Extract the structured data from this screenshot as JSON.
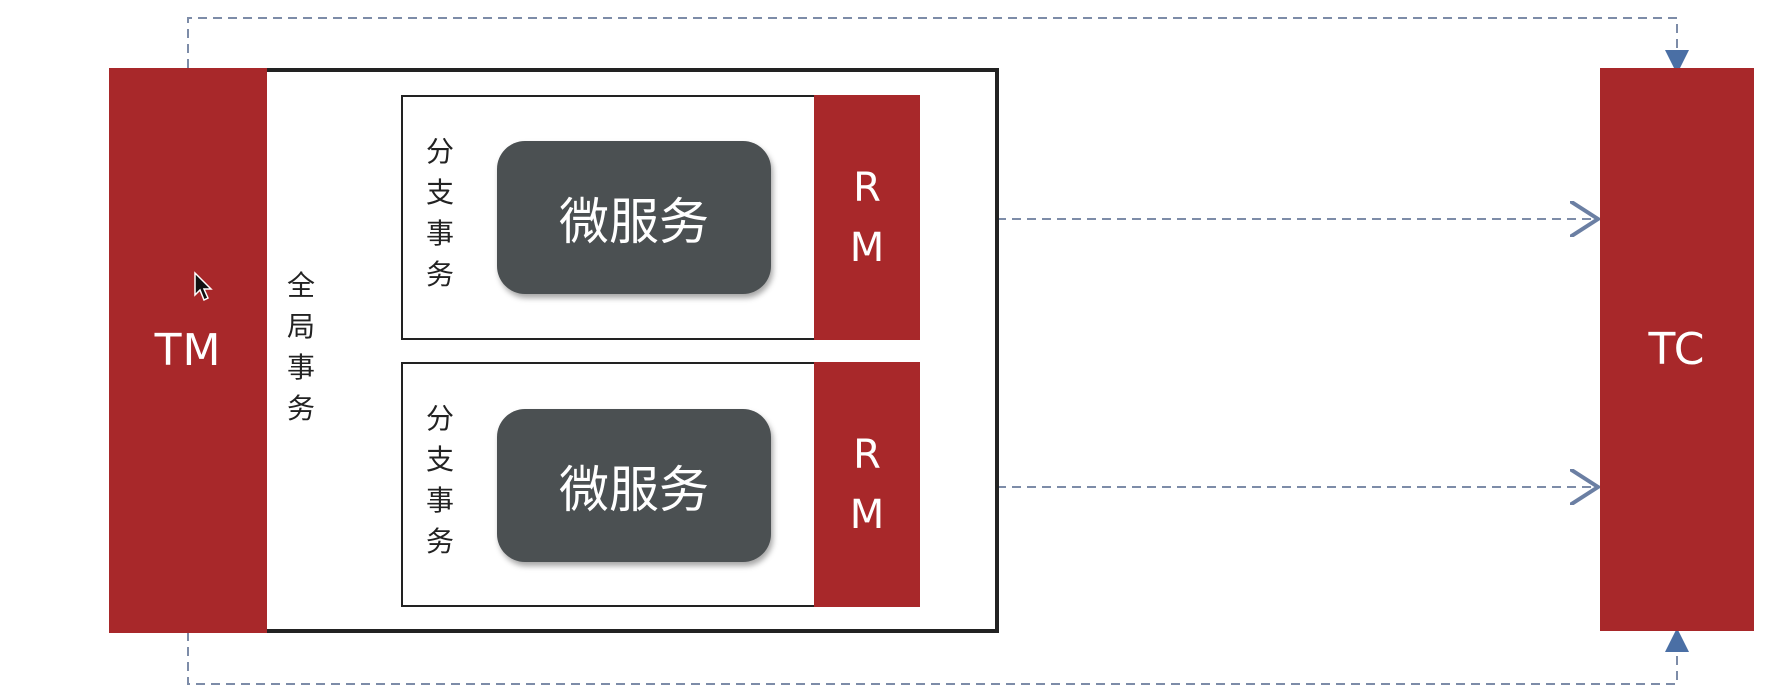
{
  "tm": {
    "label": "TM"
  },
  "tc": {
    "label": "TC"
  },
  "global_transaction": {
    "label": "全局事务"
  },
  "branches": [
    {
      "label": "分支事务",
      "service": "微服务",
      "rm": "R\nM"
    },
    {
      "label": "分支事务",
      "service": "微服务",
      "rm": "R\nM"
    }
  ],
  "colors": {
    "block": "#a8282a",
    "service": "#4b5052",
    "arrow": "#6b7fa3"
  }
}
